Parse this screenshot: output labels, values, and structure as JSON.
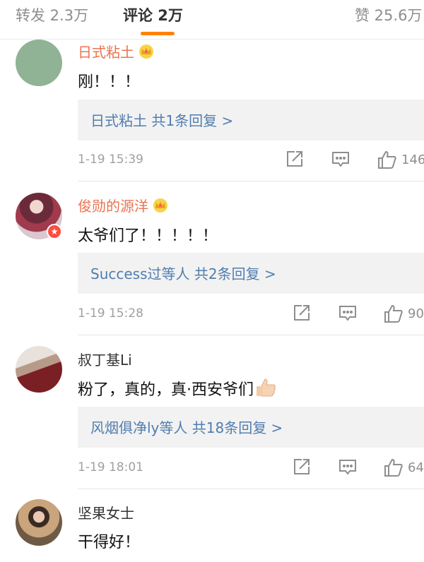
{
  "tabs": {
    "repost": "转发 2.3万",
    "comment": "评论 2万",
    "like": "赞 25.6万"
  },
  "colors": {
    "accent": "#ff8200",
    "vip_name": "#eb7350",
    "link": "#507daf"
  },
  "comments": [
    {
      "username": "日式粘土",
      "vip": true,
      "text": "刚！！！",
      "replies": "日式粘土  共1条回复 >",
      "time": "1-19 15:39",
      "likes": "146"
    },
    {
      "username": "俊勋的源洋",
      "vip": true,
      "text": "太爷们了！！！！！",
      "replies": "Success过等人  共2条回复 >",
      "time": "1-19 15:28",
      "likes": "90"
    },
    {
      "username": "叔丁基Li",
      "vip": false,
      "text": "粉了，真的，真·西安爷们",
      "replies": "风烟俱净ly等人  共18条回复 >",
      "time": "1-19 18:01",
      "likes": "64"
    },
    {
      "username": "坚果女士",
      "vip": false,
      "text": "干得好！"
    }
  ],
  "icons": [
    "crown-icon",
    "repost-icon",
    "comment-icon",
    "like-thumb-icon",
    "thumbs-up-emoji",
    "verified-badge-icon"
  ]
}
